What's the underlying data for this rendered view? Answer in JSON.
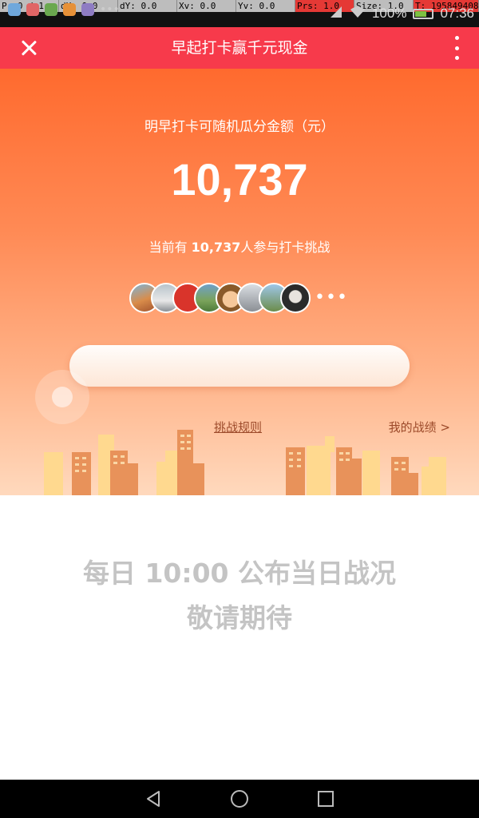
{
  "status_bar": {
    "debug": [
      "P: 0 / 1",
      "dX: 0.0",
      "dY: 0.0",
      "Xv: 0.0",
      "Yv: 0.0",
      "Prs: 1.0",
      "Size: 1.0",
      "T: 195849408"
    ],
    "battery_percent": "100%",
    "time": "07:36",
    "more": "•••"
  },
  "header": {
    "title": "早起打卡赢千元现金"
  },
  "hero": {
    "subtitle": "明早打卡可随机瓜分金额（元）",
    "amount": "10,737",
    "participants_prefix": "当前有 ",
    "participants_count": "10,737",
    "participants_suffix": "人参与打卡挑战",
    "more_dots": "•••"
  },
  "links": {
    "rules": "挑战规则",
    "my_record": "我的战绩 >"
  },
  "notice": {
    "line1": "每日 10:00 公布当日战况",
    "line2": "敬请期待"
  },
  "colors": {
    "header_bg": "#f73a4b",
    "hero_top": "#ff6a2e",
    "hero_bottom": "#ffd9bd",
    "notice_text": "#c4c4c4"
  }
}
